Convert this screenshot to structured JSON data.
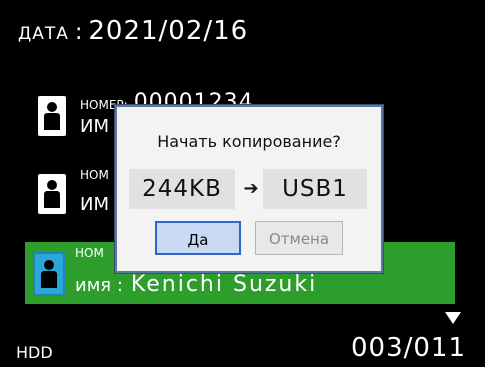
{
  "header": {
    "date_label": "ДАТА",
    "date_separator": ":",
    "date_value": "2021/02/16"
  },
  "list": {
    "items": [
      {
        "number_label": "НОМЕР:",
        "number_value": "00001234",
        "name_label": "ИМ",
        "name_value": "",
        "selected": false
      },
      {
        "number_label": "НОМ",
        "number_value": "",
        "name_label": "ИМ",
        "name_value": "",
        "selected": false
      },
      {
        "number_label": "НОМ",
        "number_value": "",
        "name_label": "имя :",
        "name_value": "Kenichi Suzuki",
        "selected": true
      }
    ]
  },
  "footer": {
    "storage": "HDD",
    "page": "003/011"
  },
  "dialog": {
    "question": "Начать копирование?",
    "size": "244KB",
    "destination": "USB1",
    "yes_label": "Да",
    "cancel_label": "Отмена"
  },
  "colors": {
    "selected_bg": "#2d9e2b",
    "dialog_border": "#5a77a8",
    "yes_bg": "#c7d9f5"
  }
}
